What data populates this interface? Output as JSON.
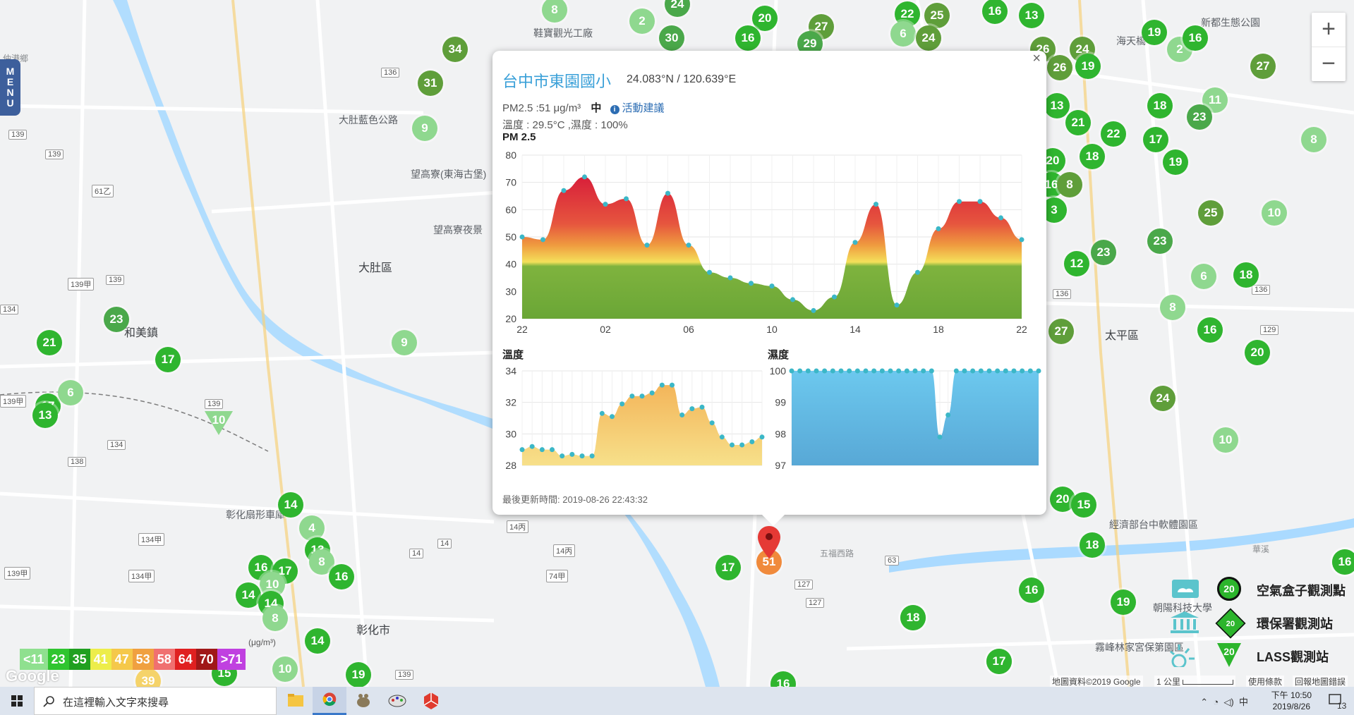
{
  "map": {
    "labels": [
      {
        "text": "仲港鄉",
        "cls": "small"
      },
      {
        "text": "鞋寶觀光工廠",
        "cls": ""
      },
      {
        "text": "大肚藍色公路",
        "cls": ""
      },
      {
        "text": "望高寮(東海古堡)",
        "cls": ""
      },
      {
        "text": "望高寮夜景",
        "cls": ""
      },
      {
        "text": "大肚區",
        "cls": "big"
      },
      {
        "text": "和美鎮",
        "cls": "big"
      },
      {
        "text": "彰化扇形車庫",
        "cls": ""
      },
      {
        "text": "彰化市",
        "cls": "big"
      },
      {
        "text": "太平區",
        "cls": "big"
      },
      {
        "text": "新都生態公園",
        "cls": ""
      },
      {
        "text": "海天橋",
        "cls": ""
      },
      {
        "text": "經濟部台中軟體園區",
        "cls": ""
      },
      {
        "text": "霧峰林家宮保第園區",
        "cls": ""
      },
      {
        "text": "朝陽科技大學",
        "cls": ""
      },
      {
        "text": "華溪",
        "cls": "small"
      },
      {
        "text": "五福西路",
        "cls": "small"
      }
    ],
    "route_shields": [
      "136",
      "139",
      "139",
      "61乙",
      "139甲",
      "139",
      "134",
      "139",
      "139甲",
      "134",
      "138",
      "134甲",
      "139甲",
      "134甲",
      "139",
      "14",
      "14",
      "14丙",
      "14丙",
      "74甲",
      "127",
      "127",
      "129",
      "136",
      "136",
      "139",
      "63"
    ],
    "markers": [
      {
        "v": "8",
        "c": "#8fd88f"
      },
      {
        "v": "2",
        "c": "#8fd88f"
      },
      {
        "v": "24",
        "c": "#4aa84a"
      },
      {
        "v": "30",
        "c": "#4aa84a"
      },
      {
        "v": "20",
        "c": "#2fb52f"
      },
      {
        "v": "16",
        "c": "#2fb52f"
      },
      {
        "v": "27",
        "c": "#5f9e3a"
      },
      {
        "v": "29",
        "c": "#4aa84a"
      },
      {
        "v": "22",
        "c": "#2fb52f"
      },
      {
        "v": "25",
        "c": "#5f9e3a"
      },
      {
        "v": "6",
        "c": "#8fd88f"
      },
      {
        "v": "24",
        "c": "#5f9e3a"
      },
      {
        "v": "16",
        "c": "#2fb52f"
      },
      {
        "v": "13",
        "c": "#2fb52f"
      },
      {
        "v": "19",
        "c": "#2fb52f"
      },
      {
        "v": "2",
        "c": "#8fd88f"
      },
      {
        "v": "16",
        "c": "#2fb52f"
      },
      {
        "v": "34",
        "c": "#5f9e3a"
      },
      {
        "v": "31",
        "c": "#5f9e3a"
      },
      {
        "v": "9",
        "c": "#8fd88f"
      },
      {
        "v": "26",
        "c": "#5f9e3a"
      },
      {
        "v": "24",
        "c": "#5f9e3a"
      },
      {
        "v": "26",
        "c": "#5f9e3a"
      },
      {
        "v": "19",
        "c": "#2fb52f"
      },
      {
        "v": "27",
        "c": "#5f9e3a"
      },
      {
        "v": "11",
        "c": "#8fd88f"
      },
      {
        "v": "13",
        "c": "#2fb52f"
      },
      {
        "v": "18",
        "c": "#2fb52f"
      },
      {
        "v": "21",
        "c": "#2fb52f"
      },
      {
        "v": "23",
        "c": "#4aa84a"
      },
      {
        "v": "22",
        "c": "#2fb52f"
      },
      {
        "v": "17",
        "c": "#2fb52f"
      },
      {
        "v": "8",
        "c": "#8fd88f"
      },
      {
        "v": "18",
        "c": "#2fb52f"
      },
      {
        "v": "19",
        "c": "#2fb52f"
      },
      {
        "v": "20",
        "c": "#2fb52f"
      },
      {
        "v": "16",
        "c": "#2fb52f"
      },
      {
        "v": "8",
        "c": "#5f9e3a"
      },
      {
        "v": "3",
        "c": "#2fb52f"
      },
      {
        "v": "25",
        "c": "#5f9e3a"
      },
      {
        "v": "10",
        "c": "#8fd88f"
      },
      {
        "v": "23",
        "c": "#4aa84a"
      },
      {
        "v": "23",
        "c": "#4aa84a"
      },
      {
        "v": "12",
        "c": "#2fb52f"
      },
      {
        "v": "6",
        "c": "#8fd88f"
      },
      {
        "v": "18",
        "c": "#2fb52f"
      },
      {
        "v": "8",
        "c": "#8fd88f"
      },
      {
        "v": "16",
        "c": "#2fb52f"
      },
      {
        "v": "27",
        "c": "#5f9e3a"
      },
      {
        "v": "20",
        "c": "#2fb52f"
      },
      {
        "v": "24",
        "c": "#5f9e3a"
      },
      {
        "v": "10",
        "c": "#8fd88f"
      },
      {
        "v": "20",
        "c": "#2fb52f"
      },
      {
        "v": "15",
        "c": "#2fb52f"
      },
      {
        "v": "18",
        "c": "#2fb52f"
      },
      {
        "v": "16",
        "c": "#2fb52f"
      },
      {
        "v": "19",
        "c": "#2fb52f"
      },
      {
        "v": "18",
        "c": "#2fb52f"
      },
      {
        "v": "17",
        "c": "#2fb52f"
      },
      {
        "v": "21",
        "c": "#2fb52f"
      },
      {
        "v": "23",
        "c": "#4aa84a"
      },
      {
        "v": "21",
        "c": "#2fb52f"
      },
      {
        "v": "17",
        "c": "#2fb52f"
      },
      {
        "v": "6",
        "c": "#8fd88f"
      },
      {
        "v": "13",
        "c": "#2fb52f"
      },
      {
        "v": "17",
        "c": "#2fb52f"
      },
      {
        "v": "9",
        "c": "#8fd88f"
      },
      {
        "v": "14",
        "c": "#2fb52f"
      },
      {
        "v": "4",
        "c": "#8fd88f"
      },
      {
        "v": "13",
        "c": "#2fb52f"
      },
      {
        "v": "8",
        "c": "#8fd88f"
      },
      {
        "v": "16",
        "c": "#2fb52f"
      },
      {
        "v": "17",
        "c": "#2fb52f"
      },
      {
        "v": "10",
        "c": "#8fd88f"
      },
      {
        "v": "16",
        "c": "#2fb52f"
      },
      {
        "v": "14",
        "c": "#2fb52f"
      },
      {
        "v": "14",
        "c": "#2fb52f"
      },
      {
        "v": "8",
        "c": "#8fd88f"
      },
      {
        "v": "14",
        "c": "#2fb52f"
      },
      {
        "v": "10",
        "c": "#8fd88f"
      },
      {
        "v": "19",
        "c": "#2fb52f"
      },
      {
        "v": "15",
        "c": "#2fb52f"
      },
      {
        "v": "39",
        "c": "#f5d36a"
      },
      {
        "v": "17",
        "c": "#2fb52f"
      },
      {
        "v": "51",
        "c": "#f08a3c"
      },
      {
        "v": "18",
        "c": "#2fb52f"
      },
      {
        "v": "16",
        "c": "#2fb52f"
      },
      {
        "v": "17",
        "c": "#2fb52f"
      },
      {
        "v": "16",
        "c": "#2fb52f"
      },
      {
        "v": "21",
        "c": "#2fb52f"
      }
    ],
    "triangle_markers": [
      {
        "v": "10",
        "c": "#8fd88f"
      }
    ]
  },
  "menu": {
    "label": "MENU"
  },
  "zoom": {
    "in": "+",
    "out": "−"
  },
  "popup": {
    "close": "×",
    "title": "台中市東園國小",
    "coord": "24.083°N / 120.639°E",
    "pm_text": "PM2.5 :51 μg/m³",
    "level": "中",
    "advice": "活動建議",
    "weather": "溫度 : 29.5°C ,濕度 : 100%",
    "pm_label": "PM 2.5",
    "temp_label": "溫度",
    "hum_label": "濕度",
    "updated": "最後更新時間: 2019-08-26 22:43:32"
  },
  "chart_data": [
    {
      "type": "area",
      "title": "PM 2.5",
      "x_ticks": [
        "22",
        "02",
        "06",
        "10",
        "14",
        "18",
        "22"
      ],
      "ylim": [
        20,
        80
      ],
      "y_ticks": [
        20,
        30,
        40,
        50,
        60,
        70,
        80
      ],
      "values": [
        50,
        49,
        67,
        72,
        62,
        64,
        47,
        66,
        47,
        37,
        35,
        33,
        32,
        27,
        23,
        28,
        48,
        62,
        25,
        37,
        53,
        63,
        63,
        57,
        49
      ],
      "grid": true
    },
    {
      "type": "area",
      "title": "溫度",
      "ylim": [
        28,
        34
      ],
      "y_ticks": [
        28,
        30,
        32,
        34
      ],
      "values": [
        29.0,
        29.2,
        29.0,
        29.0,
        28.6,
        28.7,
        28.6,
        28.6,
        31.3,
        31.1,
        31.9,
        32.4,
        32.4,
        32.6,
        33.1,
        33.1,
        31.2,
        31.6,
        31.7,
        30.7,
        29.8,
        29.3,
        29.3,
        29.5,
        29.8
      ],
      "grid": true
    },
    {
      "type": "area",
      "title": "濕度",
      "ylim": [
        97,
        100
      ],
      "y_ticks": [
        97,
        98,
        99,
        100
      ],
      "values": [
        100,
        100,
        100,
        100,
        100,
        100,
        100,
        100,
        100,
        100,
        100,
        100,
        100,
        100,
        100,
        100,
        100,
        100,
        97.9,
        98.6,
        100,
        100,
        100,
        100,
        100,
        100,
        100,
        100,
        100,
        100,
        100
      ],
      "grid": true
    }
  ],
  "scale": {
    "unit": "(μg/m³)",
    "items": [
      {
        "t": "<11",
        "c": "#8fe08f"
      },
      {
        "t": "23",
        "c": "#2fc52f"
      },
      {
        "t": "35",
        "c": "#20a020"
      },
      {
        "t": "41",
        "c": "#eded4a"
      },
      {
        "t": "47",
        "c": "#f5c84a"
      },
      {
        "t": "53",
        "c": "#f0a040"
      },
      {
        "t": "58",
        "c": "#f07070"
      },
      {
        "t": "64",
        "c": "#e02020"
      },
      {
        "t": "70",
        "c": "#a01818"
      },
      {
        "t": ">71",
        "c": "#c040e0"
      }
    ]
  },
  "legend": {
    "box": "空氣盒子觀測點",
    "epa": "環保署觀測站",
    "lass": "LASS觀測站",
    "marker_value": "20"
  },
  "attribution": {
    "data": "地圖資料©2019 Google",
    "scale": "1 公里",
    "terms": "使用條款",
    "report": "回報地圖錯誤",
    "google": "Google"
  },
  "taskbar": {
    "search": "在這裡輸入文字來搜尋",
    "time": "下午 10:50",
    "date": "2019/8/26",
    "ime": "中",
    "notif": "13"
  }
}
